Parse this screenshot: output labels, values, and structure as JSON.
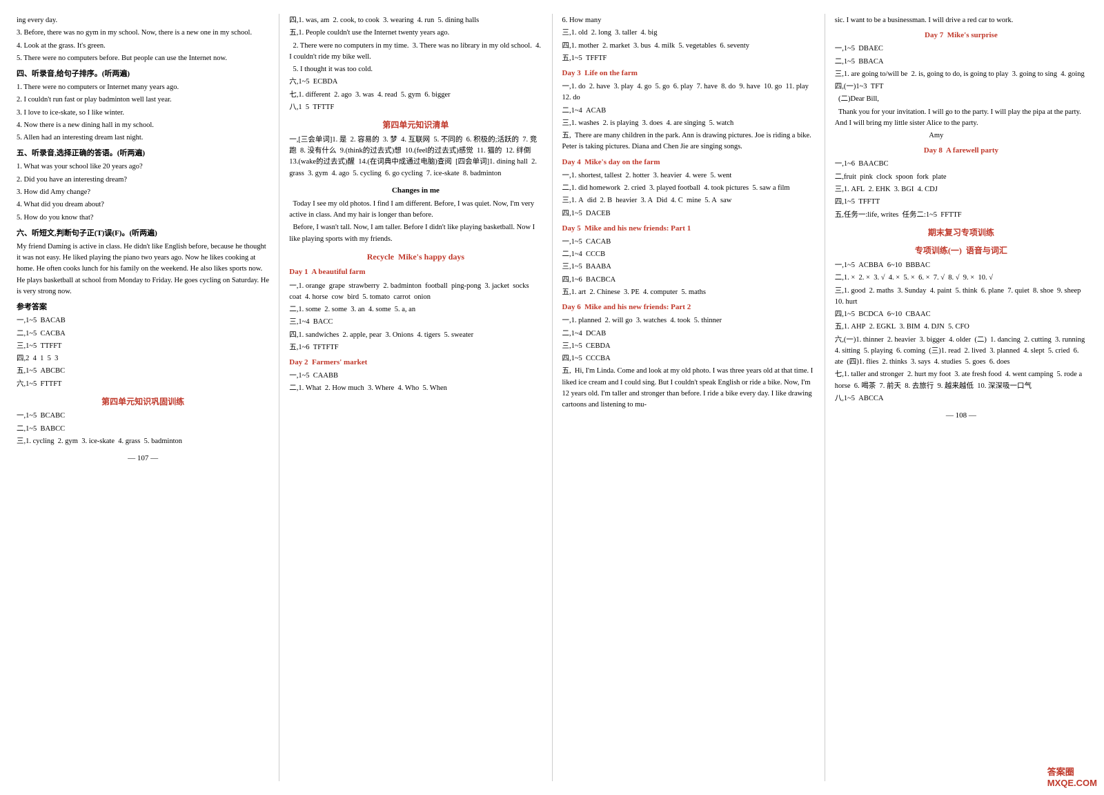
{
  "page": {
    "left_page_num": "— 107 —",
    "right_page_num": "— 108 —",
    "watermark": "答案圈\nMXQE.COM"
  },
  "col1": {
    "items": [
      "ing every day.",
      "3. Before, there was no gym in my school. Now, there is a new one in my school.",
      "4. Look at the grass. It's green.",
      "5. There were no computers before. But people can use the Internet now.",
      "四、听录音,给句子排序。(听两遍)",
      "1. There were no computers or Internet many years ago.",
      "2. I couldn't run fast or play badminton well last year.",
      "3. I love to ice-skate, so I like winter.",
      "4. Now there is a new dining hall in my school.",
      "5. Allen had an interesting dream last night.",
      "五、听录音,选择正确的答语。(听两遍)",
      "1. What was your school like 20 years ago?",
      "2. Did you have an interesting dream?",
      "3. How did Amy change?",
      "4. What did you dream about?",
      "5. How do you know that?",
      "六、听短文,判断句子正(T)误(F)。(听两遍)",
      "My friend Daming is active in class. He didn't like English before, because he thought it was not easy. He liked playing the piano two years ago. Now he likes cooking at home. He often cooks lunch for his family on the weekend. He also likes sports now. He plays basketball at school from Monday to Friday. He goes cycling on Saturday. He is very strong now.",
      "参考答案",
      "一,1~5  BACAB",
      "二,1~5  CACBA",
      "三,1~5  TTFFT",
      "四,2  4  1  5  3",
      "五,1~5  ABCBC",
      "六,1~5  FTTFT",
      "第四单元知识巩固训练",
      "一,1~5  BCABC",
      "二,1~5  BABCC",
      "三,1. cycling  2. gym  3. ice-skate  4. grass  5. badminton"
    ]
  },
  "col2": {
    "items": [
      "四,1. was, am  2. cook, to cook  3. wearing  4. run  5. dining halls",
      "五,1. People couldn't use the Internet twenty years ago.",
      "2. There were no computers in my time.  3. There was no library in my old school.  4. I couldn't ride my bike well.",
      "5. I thought it was too cold.",
      "六,1~5  ECBDA",
      "七,1. different  2. ago  3. was  4. read  5. gym  6. bigger",
      "八,1  5  TFTTF",
      "第四单元知识清单",
      "一,[三会单词]1. 是  2. 容易的  3. 梦  4. 互联网  5. 不同的  6. 积极的;活跃的  7. 竞跑  8. 没有什么  9.(think的过去式)想  10.(feel的过去式)感觉  11. 猫的  12. 绊倒  13.(wake的过去式)醒  14.(在词典中成通过电脑)查阅  [四会单词]1. dining hall  2. grass  3. gym  4. ago  5. cycling  6. go cycling  7. ice-skate  8. badminton",
      "Changes in me",
      "Today I see my old photos. I find I am different. Before, I was quiet. Now, I'm very active in class. And my hair is longer than before.",
      "Before, I wasn't tall. Now, I am taller. Before I didn't like playing basketball. Now I like playing sports with my friends.",
      "Recycle  Mike's happy days",
      "Day 1  A beautiful farm",
      "一,1. orange  grape  strawberry  2. badminton  football  ping-pong  3. jacket  socks  coat  4. horse  cow  bird  5. tomato  carrot  onion",
      "二,1. some  2. some  3. an  4. some  5. a, an",
      "三,1~4  BACC",
      "四,1. sandwiches  2. apple, pear  3. Onions  4. tigers  5. sweater",
      "五,1~6  TFTFTF",
      "Day 2  Farmers' market",
      "一,1~5  CAABB",
      "二,1. What  2. How much  3. Where  4. Who  5. When"
    ]
  },
  "col3": {
    "items": [
      "6. How many",
      "三,1. old  2. long  3. taller  4. big",
      "四,1. mother  2. market  3. bus  4. milk  5. vegetables  6. seventy",
      "五,1~5  TFFTF",
      "Day 3  Life on the farm",
      "一,1. do  2. have  3. play  4. go  5. go  6. play  7. have  8. do  9. have  10. go  11. play  12. do",
      "二,1~4  ACAB",
      "三,1. washes  2. is playing  3. does  4. are singing  5. watch",
      "五,  There are many children in the park. Ann is drawing pictures. Joe is riding a bike. Peter is taking pictures. Diana and Chen Jie are singing songs.",
      "Day 4  Mike's day on the farm",
      "一,1. shortest, tallest  2. hotter  3. heavier  4. were  5. went",
      "二,1. did homework  2. cried  3. played football  4. took pictures  5. saw a film",
      "三,1. A  did  2. B  heavier  3. A  Did  4. C  mine  5. A  saw",
      "四,1~5  DACEB",
      "Day 5  Mike and his new friends: Part 1",
      "一,1~5  CACAB",
      "二,1~4  CCCB",
      "三,1~5  BAABA",
      "四,1~6  BACBCA",
      "五,1. art  2. Chinese  3. PE  4. computer  5. maths",
      "Day 6  Mike and his new friends: Part 2",
      "一,1. planned  2. will go  3. watches  4. took  5. thinner",
      "二,1~4  DCAB",
      "三,1~5  CEBDA",
      "四,1~5  CCCBA",
      "五,  Hi, I'm Linda. Come and look at my old photo. I was three years old at that time. I liked ice cream and I could sing. But I couldn't speak English or ride a bike. Now, I'm 12 years old. I'm taller and stronger than before. I ride a bike every day. I like drawing cartoons and listening to mu-"
    ]
  },
  "col4": {
    "items": [
      "sic. I want to be a businessman. I will drive a red car to work.",
      "Day 7  Mike's surprise",
      "一,1~5  DBAEC",
      "二,1~5  BBACA",
      "三,1. are going to/will be  2. is, going to do, is going to play  3. going to sing  4. going",
      "四,(一)1~3  TFT",
      "(二)Dear Bill,",
      "Thank you for your invitation. I will go to the party. I will play the pipa at the party. And I will bring my little sister Alice to the party.",
      "Amy",
      "Day 8  A farewell party",
      "一,1~6  BAACBC",
      "二,fruit  pink  clock  spoon  fork  plate",
      "三,1. AFL  2. EHK  3. BGI  4. CDJ",
      "四,1~5  TFFTT",
      "五,任务一:life, writes  任务二:1~5  FFTTF",
      "期末复习专项训练",
      "专项训练(一)  语音与词汇",
      "一,1~5  ACBBA  6~10  BBBAC",
      "二,1. ×  2. ×  3. √  4. ×  5. ×  6. ×  7. √  8. √  9. ×  10. √",
      "三,1. good  2. maths  3. Sunday  4. paint  5. think  6. plane  7. quiet  8. shoe  9. sheep  10. hurt",
      "四,1~5  BCDCA  6~10  CBAAC",
      "五,1. AHP  2. EGKL  3. BIM  4. DJN  5. CFO",
      "六,(一)1. thinner  2. heavier  3. bigger  4. older  (二)  1. dancing  2. cutting  3. running  4. sitting  5. playing  6. coming  (三)1. read  2. lived  3. planned  4. slept  5. cried  6. ate  (四)1. flies  2. thinks  3. says  4. studies  5. goes  6. does",
      "七,1. taller and stronger  2. hurt my foot  3. ate fresh food  4. went camping  5. rode a horse  6. 喝茶  7. 前天  8. 去旅行  9. 越来越低  10. 深深吸一口气",
      "八,1~5  ABCCA"
    ]
  }
}
